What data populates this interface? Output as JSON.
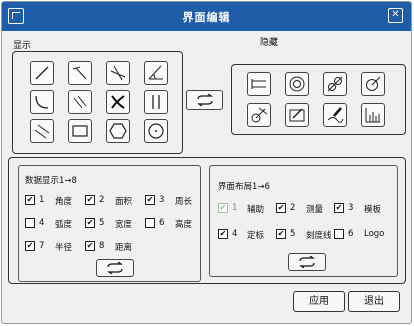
{
  "window": {
    "title": "界面编辑",
    "close": "✕"
  },
  "labels": {
    "display": "显示",
    "hidden": "隐藏"
  },
  "display_tools": [
    {
      "icon": "line-icon"
    },
    {
      "icon": "perpendicular-line-icon"
    },
    {
      "icon": "intersect-lines-icon"
    },
    {
      "icon": "angle-icon"
    },
    {
      "icon": "arc-icon"
    },
    {
      "icon": "parallel-diagonal-icon"
    },
    {
      "icon": "curve-cross-icon"
    },
    {
      "icon": "parallel-lines-icon"
    },
    {
      "icon": "slash-parallel-icon"
    },
    {
      "icon": "rectangle-icon"
    },
    {
      "icon": "hexagon-icon"
    },
    {
      "icon": "circle-icon"
    }
  ],
  "hidden_tools": [
    {
      "icon": "distance-icon"
    },
    {
      "icon": "concentric-circle-icon"
    },
    {
      "icon": "two-circles-icon"
    },
    {
      "icon": "point-circle-icon"
    },
    {
      "icon": "circle-tangent-icon"
    },
    {
      "icon": "edit-image-icon"
    },
    {
      "icon": "pen-draw-icon"
    },
    {
      "icon": "histogram-icon"
    }
  ],
  "data_display": {
    "title": "数据显示1→8",
    "options": [
      {
        "num": "1",
        "label": "角度",
        "checked": true
      },
      {
        "num": "2",
        "label": "面积",
        "checked": true
      },
      {
        "num": "3",
        "label": "周长",
        "checked": true
      },
      {
        "num": "4",
        "label": "弧度",
        "checked": false
      },
      {
        "num": "5",
        "label": "宽度",
        "checked": true
      },
      {
        "num": "6",
        "label": "高度",
        "checked": false
      },
      {
        "num": "7",
        "label": "半径",
        "checked": true
      },
      {
        "num": "8",
        "label": "距离",
        "checked": true
      }
    ]
  },
  "layout": {
    "title": "界面布局1→6",
    "options": [
      {
        "num": "1",
        "label": "辅助",
        "checked": true,
        "disabled": true
      },
      {
        "num": "2",
        "label": "测量",
        "checked": true
      },
      {
        "num": "3",
        "label": "模板",
        "checked": true
      },
      {
        "num": "4",
        "label": "定标",
        "checked": true
      },
      {
        "num": "5",
        "label": "刻度线",
        "checked": true
      },
      {
        "num": "6",
        "label": "Logo",
        "checked": false
      }
    ]
  },
  "buttons": {
    "apply": "应用",
    "exit": "退出"
  }
}
